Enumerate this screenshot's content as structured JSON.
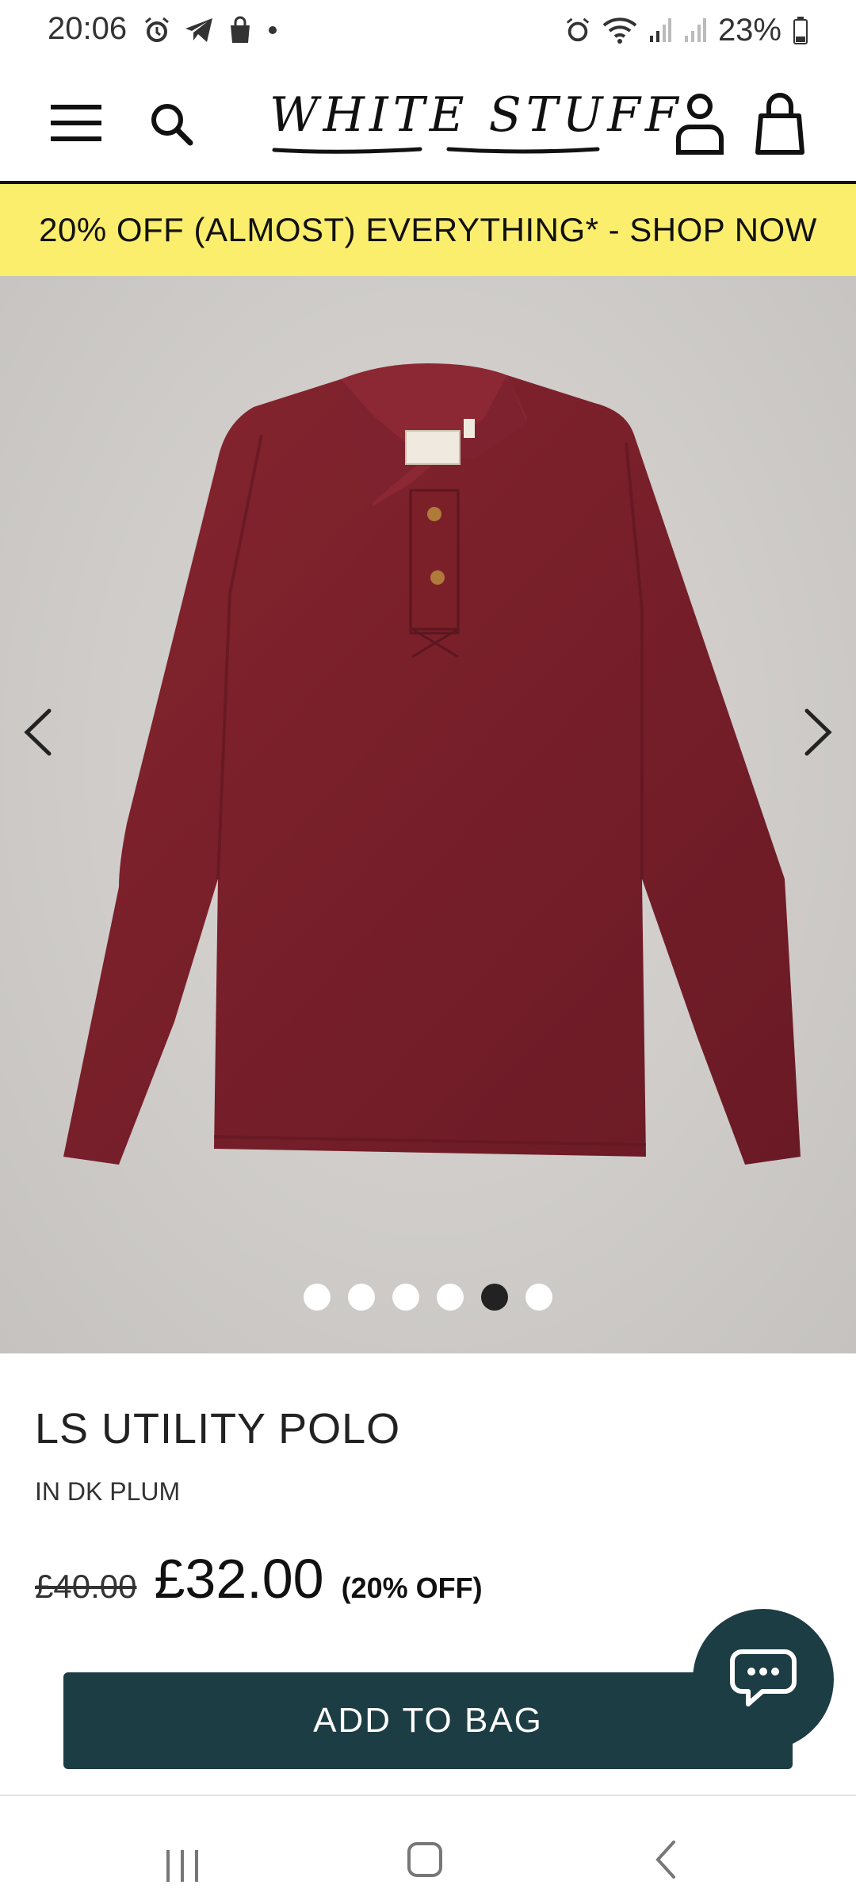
{
  "status_bar": {
    "time": "20:06",
    "battery": "23%",
    "icons_left": [
      "alarm-icon",
      "telegram-icon",
      "shopping-bag-icon",
      "dot-icon"
    ],
    "icons_right": [
      "alarm-icon",
      "wifi-icon",
      "signal-icon",
      "signal-icon",
      "battery-icon"
    ]
  },
  "header": {
    "logo_text": "WHITE STUFF",
    "icons": [
      "menu-icon",
      "search-icon",
      "account-icon",
      "bag-icon"
    ]
  },
  "promo": {
    "text": "20% OFF (ALMOST) EVERYTHING* - SHOP NOW",
    "background": "#fcee6d"
  },
  "gallery": {
    "image_count": 6,
    "active_index": 4,
    "product_color": "#7a1f2b"
  },
  "product": {
    "title": "LS UTILITY POLO",
    "colour": "IN DK PLUM",
    "old_price": "£40.00",
    "price": "£32.00",
    "discount": "(20% OFF)"
  },
  "actions": {
    "add_to_bag": "ADD TO BAG",
    "button_color": "#1c3d43"
  }
}
